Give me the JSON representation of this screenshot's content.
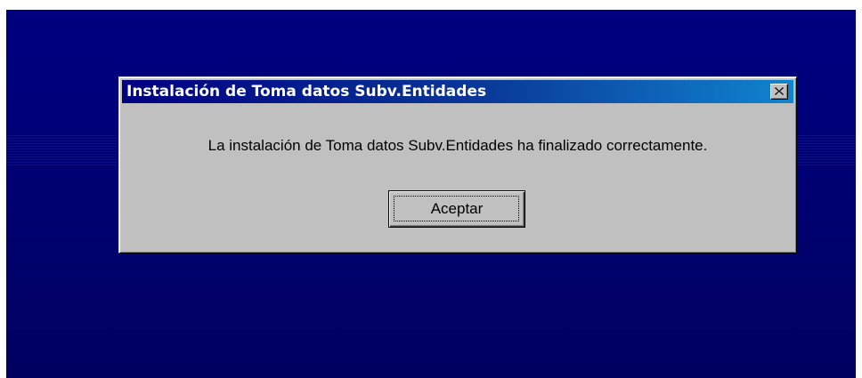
{
  "dialog": {
    "title": "Instalación de Toma datos Subv.Entidades",
    "message": "La instalación de Toma datos Subv.Entidades ha finalizado correctamente.",
    "ok_label": "Aceptar",
    "close_icon": "close-icon"
  },
  "colors": {
    "desktop_background": "#000080",
    "dialog_face": "#c0c0c0",
    "titlebar_active": "#000080",
    "titlebar_gradient_end": "#1084d0",
    "title_text": "#ffffff"
  }
}
